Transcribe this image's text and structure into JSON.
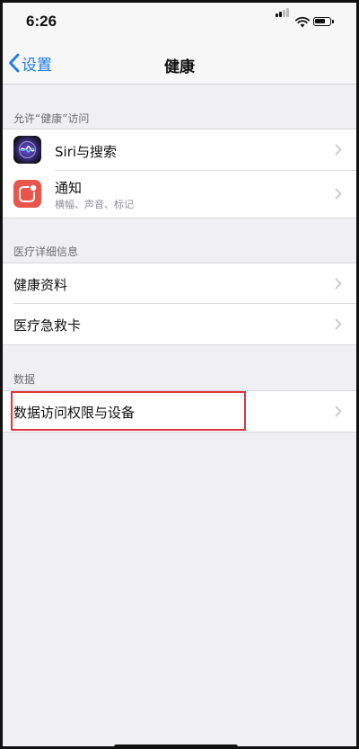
{
  "status_bar": {
    "time": "6:26"
  },
  "nav": {
    "back_label": "设置",
    "title": "健康"
  },
  "sections": {
    "access": {
      "header": "允许“健康”访问",
      "items": [
        {
          "label": "Siri与搜索",
          "icon": "siri-icon"
        },
        {
          "label": "通知",
          "subtitle": "横幅、声音、标记",
          "icon": "notifications-icon"
        }
      ]
    },
    "medical": {
      "header": "医疗详细信息",
      "items": [
        {
          "label": "健康资料"
        },
        {
          "label": "医疗急救卡"
        }
      ]
    },
    "data": {
      "header": "数据",
      "items": [
        {
          "label": "数据访问权限与设备",
          "highlighted": true
        }
      ]
    }
  },
  "colors": {
    "accent": "#1b7af3",
    "highlight_border": "#e0353f",
    "background": "#efeff4",
    "notification_icon": "#e9554a"
  }
}
